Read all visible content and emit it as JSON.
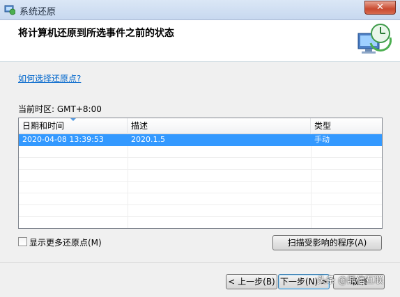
{
  "window": {
    "title": "系统还原",
    "close_label": "✕"
  },
  "header": {
    "title": "将计算机还原到所选事件之前的状态"
  },
  "help_link": "如何选择还原点?",
  "timezone": "当前时区: GMT+8:00",
  "table": {
    "columns": [
      "日期和时间",
      "描述",
      "类型"
    ],
    "rows": [
      {
        "date": "2020-04-08 13:39:53",
        "description": "2020.1.5",
        "type": "手动",
        "selected": true
      }
    ]
  },
  "show_more": {
    "label": "显示更多还原点(M)",
    "checked": false
  },
  "scan_button": "扫描受影响的程序(A)",
  "footer": {
    "back_label": "< 上一步(B)",
    "next_label": "下一步(N) >",
    "cancel_label": "取消"
  },
  "watermark": "头条 @鼎信互联",
  "colors": {
    "selection": "#3399ff",
    "link": "#0066cc",
    "header_bg": "#ffffff"
  }
}
